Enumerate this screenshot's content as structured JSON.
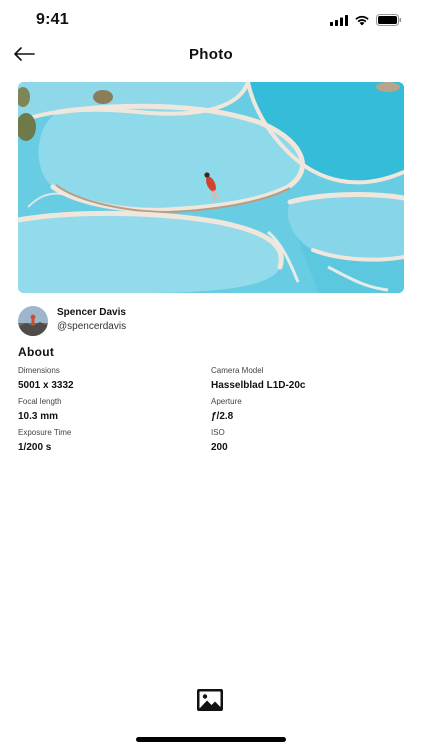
{
  "status_bar": {
    "time": "9:41"
  },
  "nav": {
    "title": "Photo",
    "back_icon": "arrow-left-icon"
  },
  "photo": {
    "subject": "aerial view of turquoise travertine pools"
  },
  "author": {
    "name": "Spencer Davis",
    "handle": "@spencerdavis"
  },
  "about": {
    "heading": "About",
    "specs": [
      {
        "label": "Dimensions",
        "value": "5001 x 3332"
      },
      {
        "label": "Camera Model",
        "value": "Hasselblad L1D-20c"
      },
      {
        "label": "Focal length",
        "value": "10.3 mm"
      },
      {
        "label": "Aperture",
        "value": "ƒ/2.8"
      },
      {
        "label": "Exposure Time",
        "value": "1/200 s"
      },
      {
        "label": "ISO",
        "value": "200"
      }
    ]
  },
  "bottom_bar": {
    "icon": "image-gallery-icon"
  },
  "colors": {
    "text": "#111111",
    "pool": "#7fd3e6",
    "pool_deep": "#3fb9d6",
    "rim": "#e8ddd3"
  }
}
